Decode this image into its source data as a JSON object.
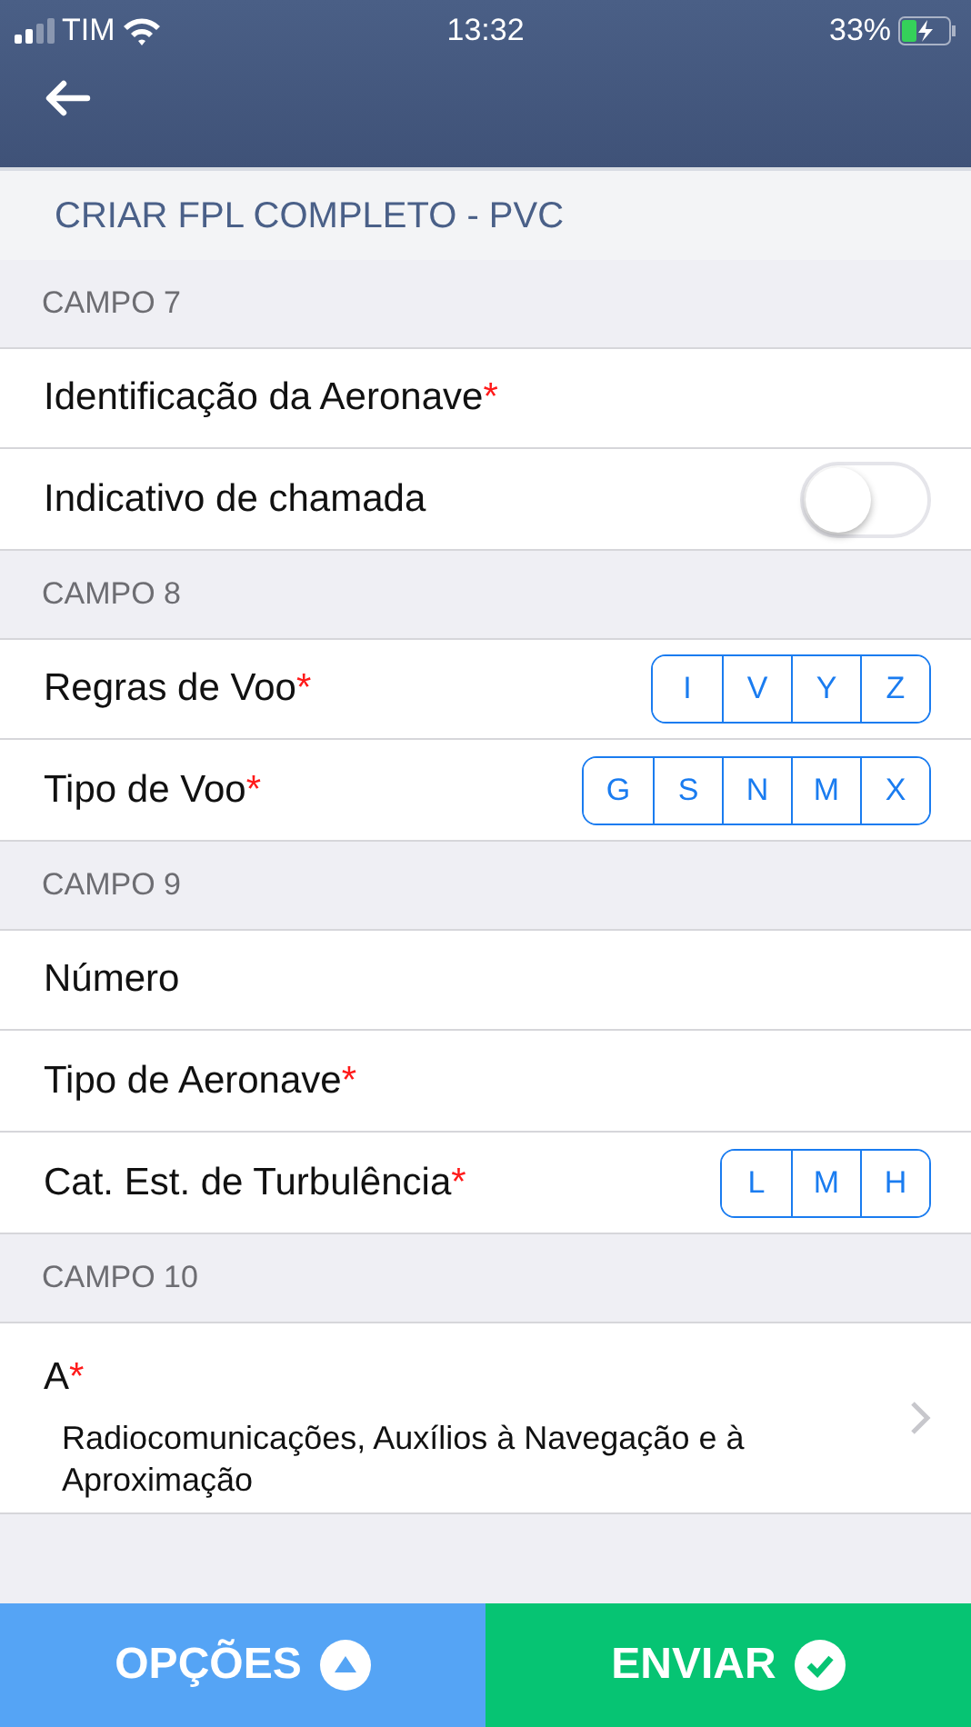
{
  "status_bar": {
    "carrier": "TIM",
    "time": "13:32",
    "battery": "33%"
  },
  "title": "CRIAR FPL COMPLETO - PVC",
  "sections": [
    {
      "header": "CAMPO 7",
      "rows": [
        {
          "kind": "text",
          "label": "Identificação da Aeronave",
          "required_mark": "*"
        },
        {
          "kind": "toggle",
          "label": "Indicativo de chamada",
          "on": false
        }
      ]
    },
    {
      "header": "CAMPO 8",
      "rows": [
        {
          "kind": "segment",
          "label": "Regras de Voo",
          "required_mark": "*",
          "options": [
            {
              "label": "I",
              "selected": false
            },
            {
              "label": "V",
              "selected": false
            },
            {
              "label": "Y",
              "selected": false
            },
            {
              "label": "Z",
              "selected": false
            }
          ]
        },
        {
          "kind": "segment",
          "label": "Tipo de Voo",
          "required_mark": "*",
          "options": [
            {
              "label": "G",
              "selected": false
            },
            {
              "label": "S",
              "selected": false
            },
            {
              "label": "N",
              "selected": false
            },
            {
              "label": "M",
              "selected": false
            },
            {
              "label": "X",
              "selected": false
            }
          ]
        }
      ]
    },
    {
      "header": "CAMPO 9",
      "rows": [
        {
          "kind": "text",
          "label": "Número"
        },
        {
          "kind": "text",
          "label": "Tipo de Aeronave",
          "required_mark": "*"
        },
        {
          "kind": "segment",
          "label": "Cat. Est. de Turbulência",
          "required_mark": "*",
          "options": [
            {
              "label": "L",
              "selected": false
            },
            {
              "label": "M",
              "selected": false
            },
            {
              "label": "H",
              "selected": false
            }
          ]
        }
      ]
    },
    {
      "header": "CAMPO 10",
      "rows": [
        {
          "kind": "detail",
          "label": "A",
          "required_mark": "*",
          "detail": "Radiocomunicações, Auxílios à Navegação e à Aproximação"
        }
      ]
    }
  ],
  "footer": [
    {
      "kind": "options",
      "label": "OPÇÕES"
    },
    {
      "kind": "send",
      "label": "ENVIAR"
    }
  ]
}
